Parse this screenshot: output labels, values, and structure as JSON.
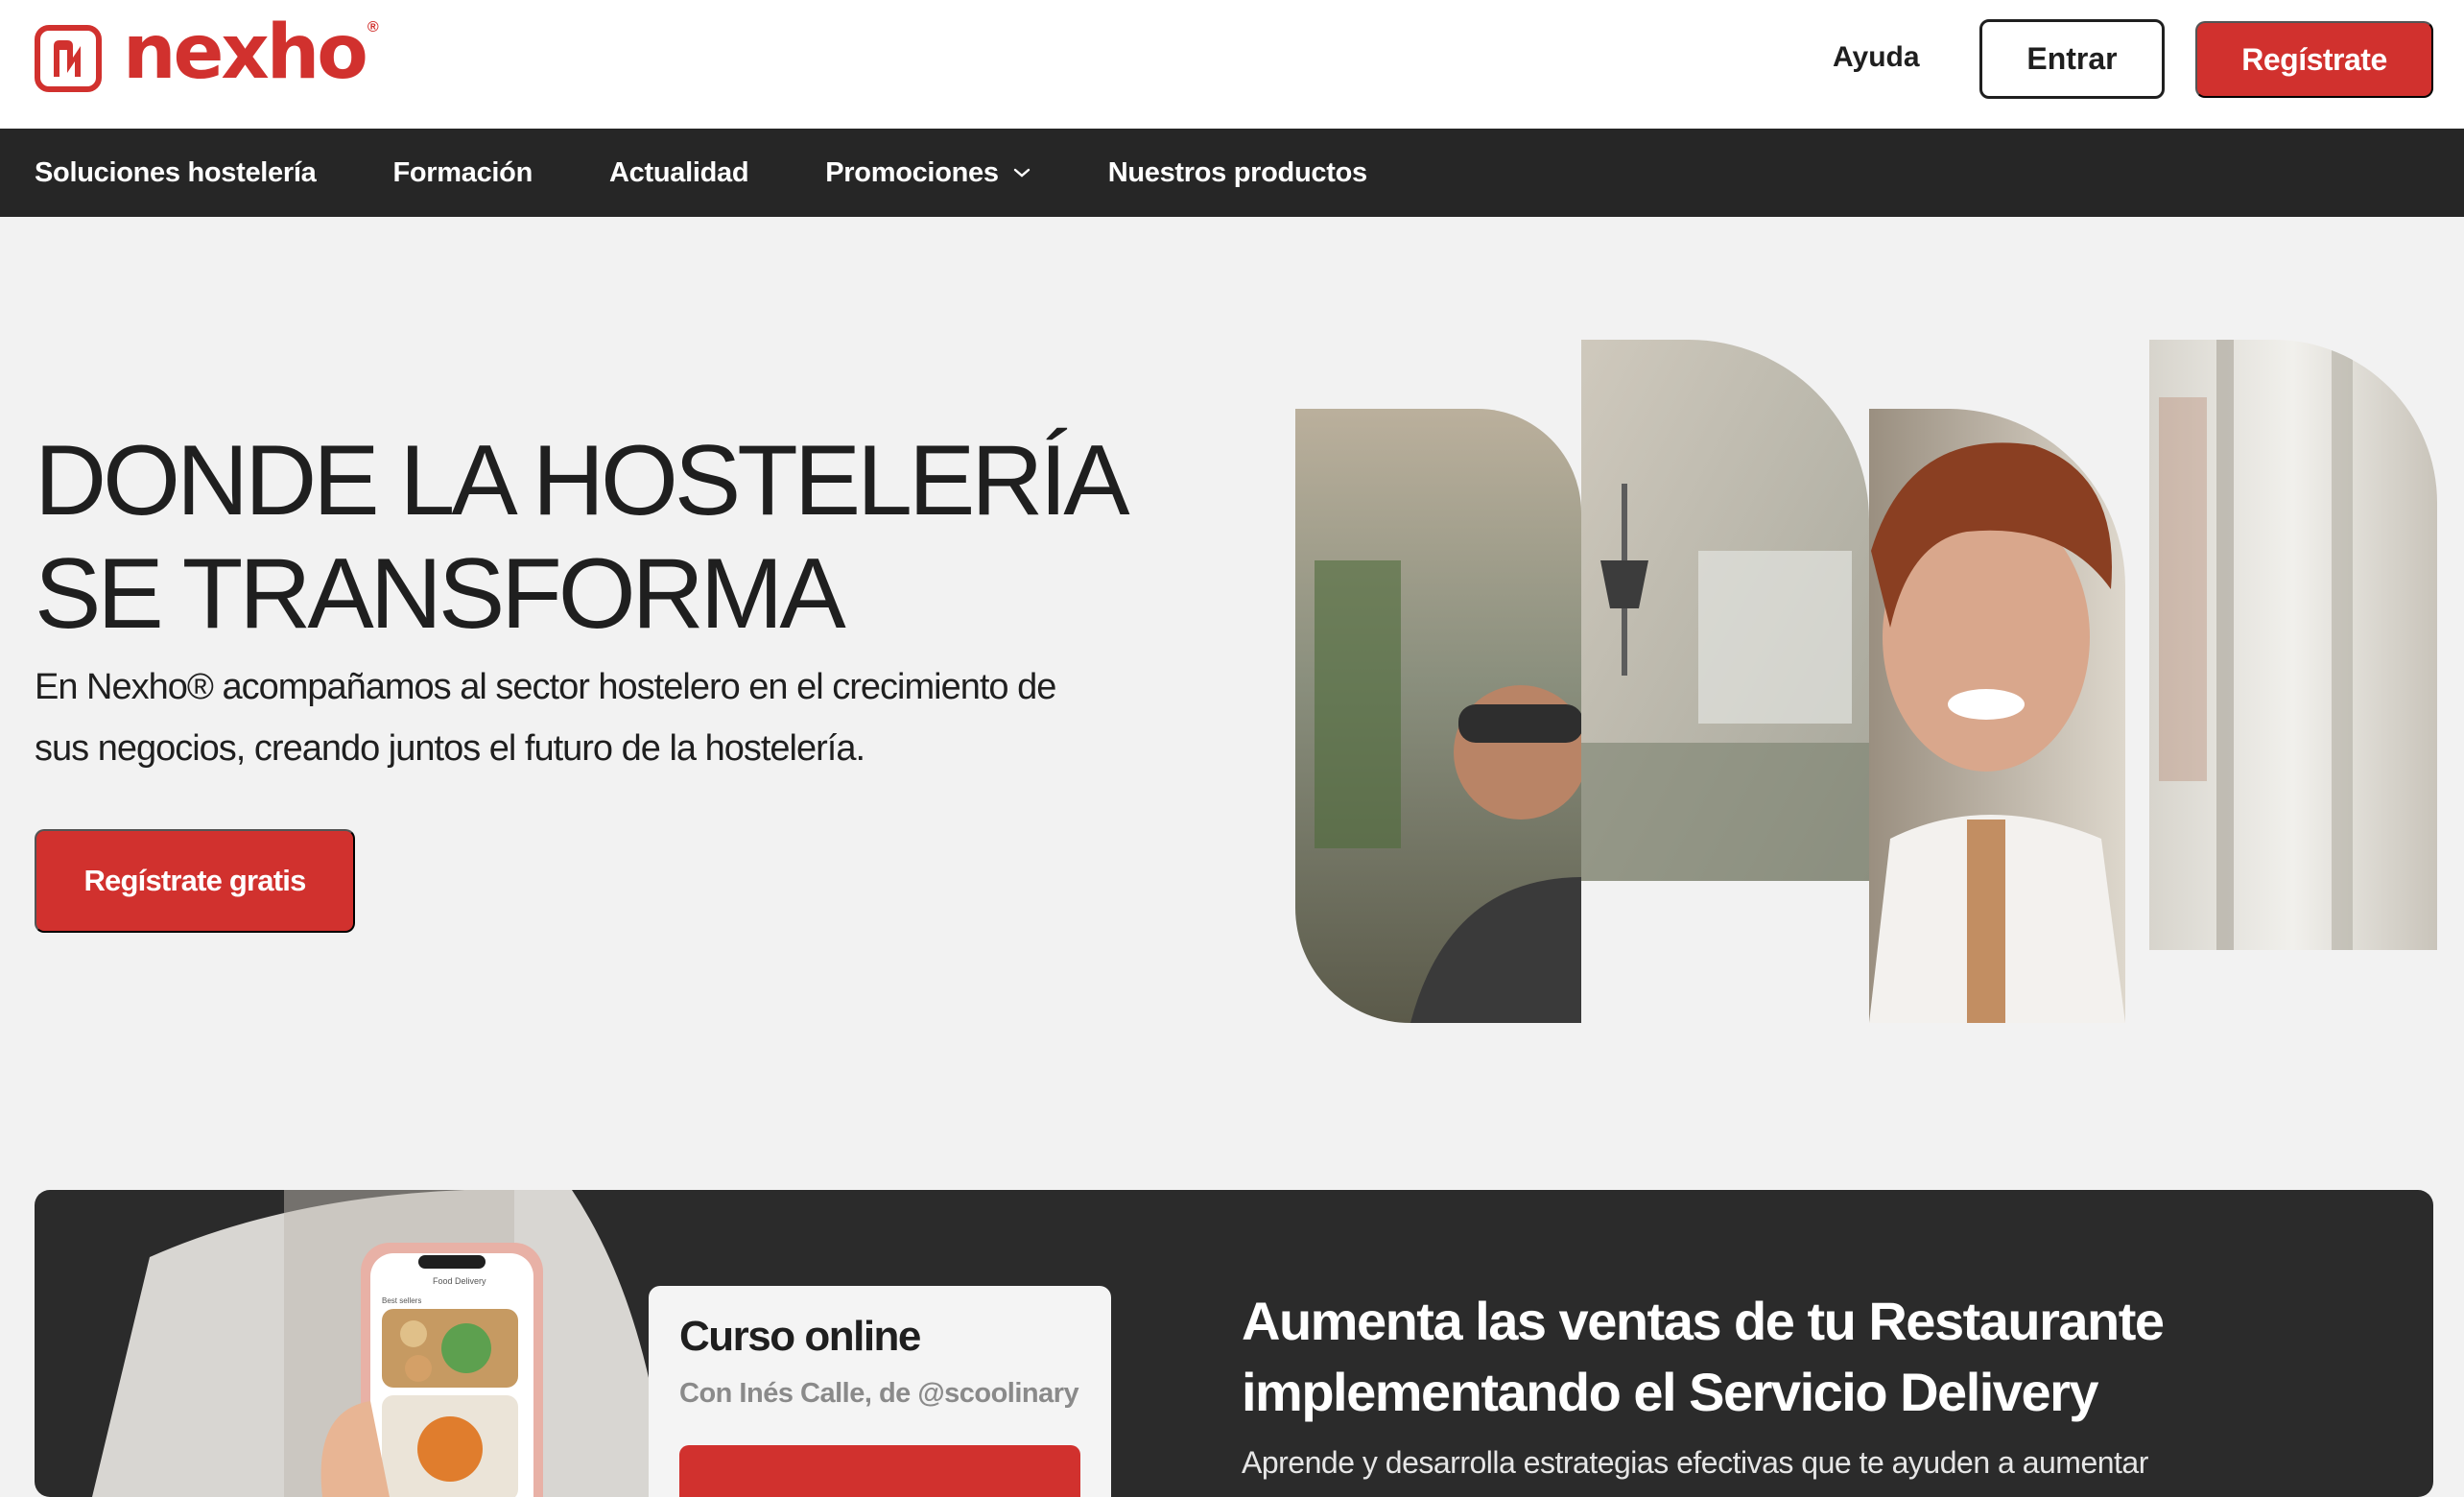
{
  "brand": {
    "name": "nexho",
    "reg_mark": "®",
    "accent": "#d1312e",
    "dark": "#262626"
  },
  "header": {
    "help_label": "Ayuda",
    "login_label": "Entrar",
    "register_label": "Regístrate"
  },
  "nav": {
    "items": [
      {
        "label": "Soluciones hostelería"
      },
      {
        "label": "Formación"
      },
      {
        "label": "Actualidad"
      },
      {
        "label": "Promociones",
        "has_dropdown": true
      },
      {
        "label": "Nuestros productos"
      }
    ]
  },
  "hero": {
    "title_line1": "DONDE LA HOSTELERÍA",
    "title_line2": "SE TRANSFORMA",
    "subtitle_line1": "En Nexho® acompañamos al sector hostelero en el crecimiento de",
    "subtitle_line2": "sus negocios, creando juntos el futuro de la hostelería.",
    "cta_label": "Regístrate gratis"
  },
  "promo": {
    "phone_header": "Food Delivery",
    "phone_section": "Best sellers",
    "course_title": "Curso online",
    "course_author": "Con Inés Calle, de @scoolinary",
    "title_line1": "Aumenta las ventas de tu Restaurante",
    "title_line2": "implementando el Servicio Delivery",
    "text": "Aprende y desarrolla estrategias efectivas que te ayuden a aumentar"
  }
}
